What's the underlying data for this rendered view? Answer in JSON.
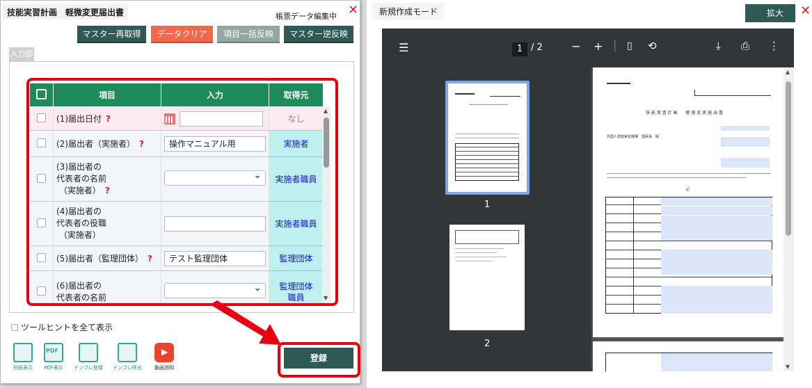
{
  "left_panel": {
    "title": "技能実習計画　軽微変更届出書",
    "status": "帳票データ編集中",
    "close_glyph": "✕",
    "toolbar": {
      "master_refetch": "マスター再取得",
      "data_clear": "データクリア",
      "bulk_reflect": "項目一括反映",
      "master_reverse": "マスター逆反映"
    },
    "input_tab": "入力部",
    "grid": {
      "headers": {
        "item": "項目",
        "input": "入力",
        "source": "取得元"
      },
      "rows": [
        {
          "label": "(1)届出日付",
          "value": "",
          "source": "なし"
        },
        {
          "label": "(2)届出者（実施者）",
          "value": "操作マニュアル用",
          "source": "実施者"
        },
        {
          "label": "(3)届出者の代表者の名前（実施者）",
          "value": "",
          "source": "実施者職員"
        },
        {
          "label": "(4)届出者の代表者の役職（実施者）",
          "value": "",
          "source": "実施者職員"
        },
        {
          "label": "(5)届出者（監理団体）",
          "value": "テスト監理団体",
          "source": "監理団体"
        },
        {
          "label": "(6)届出者の代表者の名前",
          "value": "",
          "source": "監理団体職員"
        }
      ],
      "row_lines": {
        "r3": [
          "(3)届出者の",
          "代表者の名前",
          "（実施者）"
        ],
        "r4": [
          "(4)届出者の",
          "代表者の役職",
          "（実施者）"
        ],
        "r6": [
          "(6)届出者の",
          "代表者の名前"
        ],
        "r6_src": [
          "監理団体",
          "職員"
        ]
      },
      "help_glyph": "?"
    },
    "tooltip_toggle": "ツールヒントを全て表示",
    "footer_icons": [
      "別紙表示",
      "PDF表示",
      "テンプレ登録",
      "テンプレ呼出",
      "動画説明"
    ],
    "pdf_icon_text": "PDF",
    "register_button": "登録"
  },
  "right_panel": {
    "mode": "新規作成モード",
    "zoom_button": "拡大",
    "close_glyph": "✕",
    "viewer": {
      "page_current": "1",
      "page_total": "/ 2",
      "thumb_labels": [
        "1",
        "2"
      ]
    },
    "document": {
      "form_title": "技 能 実 習 計 画　　軽 微 変 更 届 出 書",
      "addressee": "外国人技能実習機構　理事長　殿",
      "note": "記"
    }
  },
  "colors": {
    "header_green": "#1f8a5a",
    "dark_teal": "#2e5954",
    "orange": "#f4674a",
    "highlight_red": "#e60012",
    "source_cyan": "#bff0f0"
  }
}
